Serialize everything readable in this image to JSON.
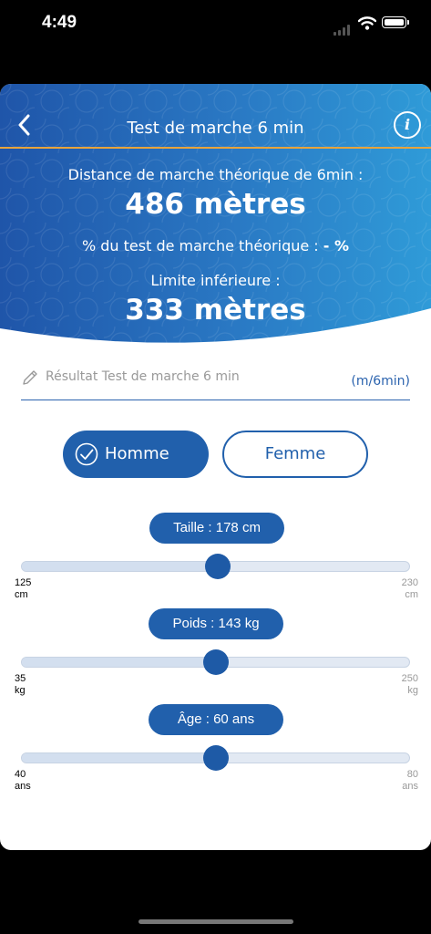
{
  "status": {
    "time": "4:49"
  },
  "header": {
    "title": "Test de marche 6 min",
    "info_label": "i",
    "theoretical_label": "Distance de marche théorique de 6min :",
    "theoretical_value": "486 mètres",
    "percent_label": "% du test de marche théorique : ",
    "percent_value": "- %",
    "lower_label": "Limite inférieure :",
    "lower_value": "333 mètres"
  },
  "result_field": {
    "placeholder": "Résultat Test de marche 6 min",
    "unit": "(m/6min)"
  },
  "gender": {
    "male": "Homme",
    "female": "Femme",
    "selected": "Homme"
  },
  "sliders": {
    "height": {
      "label": "Taille : 178 cm",
      "min": "125",
      "min_unit": "cm",
      "max": "230",
      "max_unit": "cm",
      "value": 178,
      "range": [
        125,
        230
      ]
    },
    "weight": {
      "label": "Poids : 143 kg",
      "min": "35",
      "min_unit": "kg",
      "max": "250",
      "max_unit": "kg",
      "value": 143,
      "range": [
        35,
        250
      ]
    },
    "age": {
      "label": "Âge : 60 ans",
      "min": "40",
      "min_unit": "ans",
      "max": "80",
      "max_unit": "ans",
      "value": 60,
      "range": [
        40,
        80
      ]
    }
  },
  "colors": {
    "primary": "#2160ac",
    "accent_line": "#e8a43c",
    "header_start": "#1f55a9",
    "header_end": "#2f9bd8"
  },
  "icons": {
    "back": "chevron-left-icon",
    "info": "info-icon",
    "pencil": "pencil-icon",
    "check": "check-circle-icon"
  }
}
